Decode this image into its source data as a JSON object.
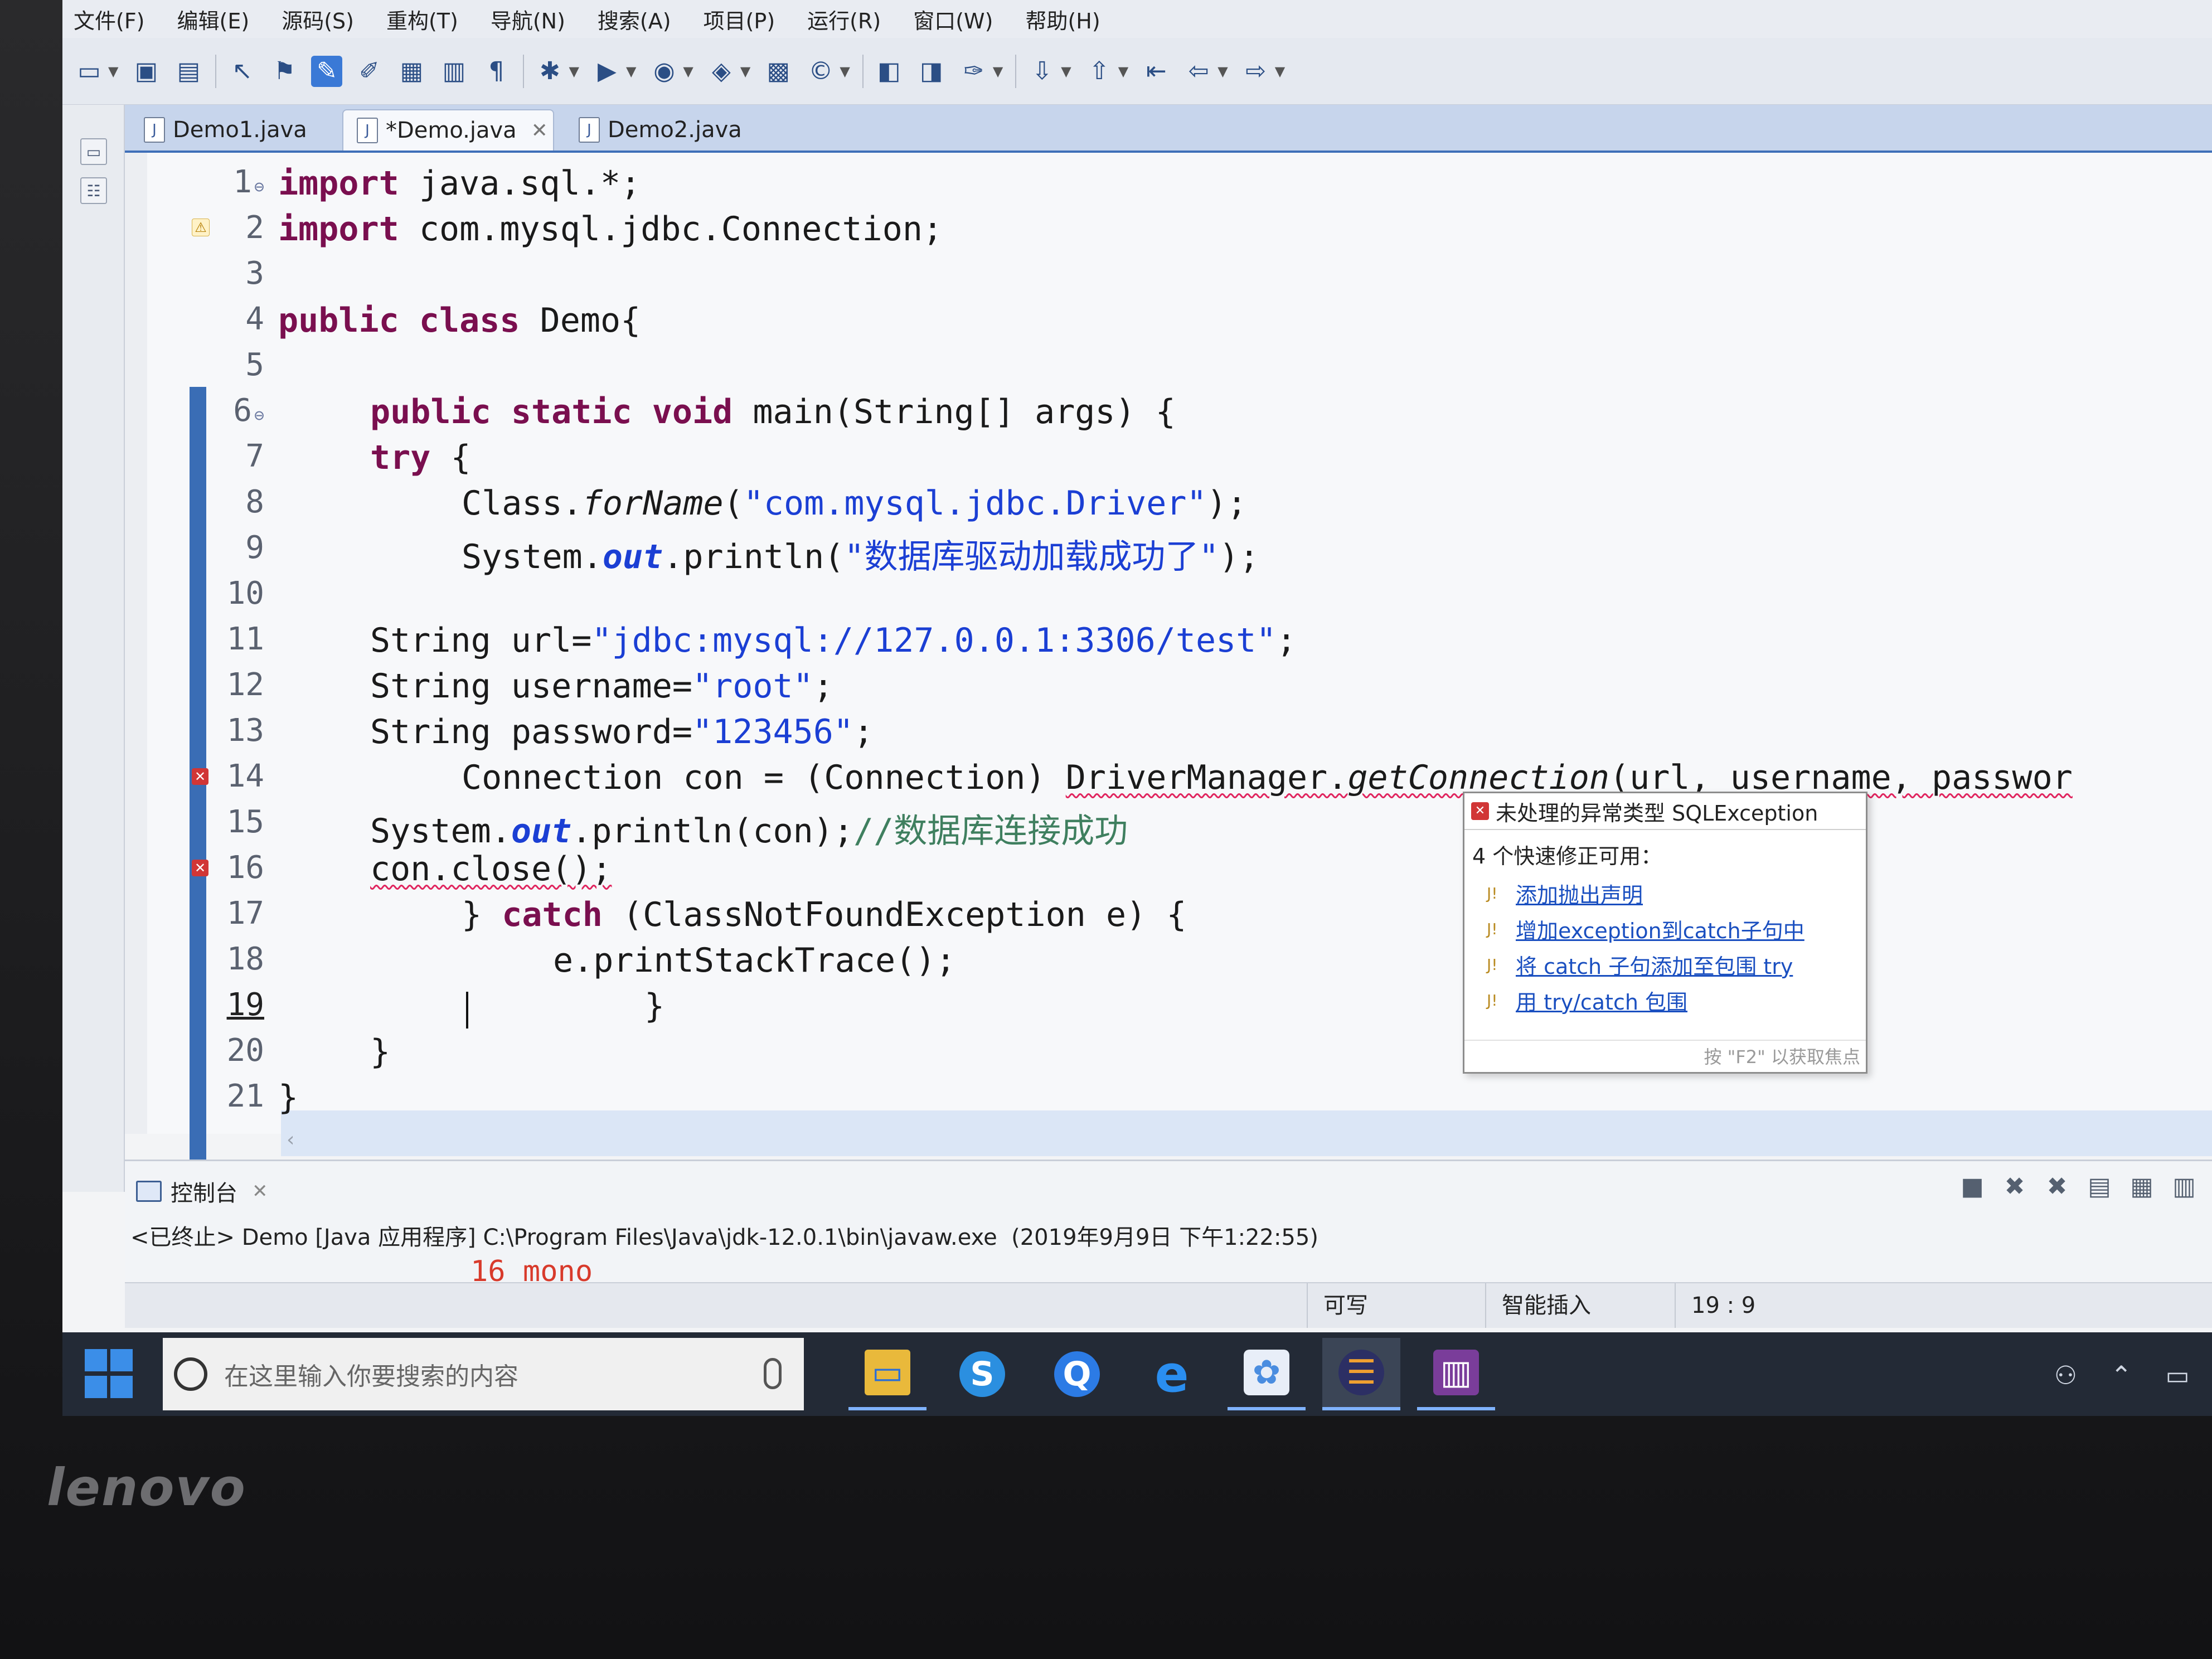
{
  "menubar": {
    "items": [
      "文件(F)",
      "编辑(E)",
      "源码(S)",
      "重构(T)",
      "导航(N)",
      "搜索(A)",
      "项目(P)",
      "运行(R)",
      "窗口(W)",
      "帮助(H)"
    ]
  },
  "tabs": [
    {
      "label": "Demo1.java",
      "active": false
    },
    {
      "label": "*Demo.java",
      "active": true
    },
    {
      "label": "Demo2.java",
      "active": false
    }
  ],
  "editor": {
    "line_numbers": [
      "1",
      "2",
      "3",
      "4",
      "5",
      "6",
      "7",
      "8",
      "9",
      "10",
      "11",
      "12",
      "13",
      "14",
      "15",
      "16",
      "17",
      "18",
      "19",
      "20",
      "21"
    ],
    "current_line": "19",
    "code": {
      "l1_kw": "import",
      "l1_rest": " java.sql.*;",
      "l2_kw": "import",
      "l2_rest": " com.mysql.jdbc.Connection;",
      "l4_kw": "public class",
      "l4_rest": " Demo{",
      "l6_kw": "public static void",
      "l6_rest": " main(String[] args) {",
      "l7_kw": "try",
      "l7_rest": " {",
      "l8_a": "Class.",
      "l8_m": "forName",
      "l8_b": "(",
      "l8_s": "\"com.mysql.jdbc.Driver\"",
      "l8_c": ");",
      "l9_a": "System.",
      "l9_f": "out",
      "l9_b": ".println(",
      "l9_s": "\"数据库驱动加载成功了\"",
      "l9_c": ");",
      "l11_a": "String url=",
      "l11_s": "\"jdbc:mysql://127.0.0.1:3306/test\"",
      "l11_c": ";",
      "l12_a": "String username=",
      "l12_s": "\"root\"",
      "l12_c": ";",
      "l13_a": "String password=",
      "l13_s": "\"123456\"",
      "l13_c": ";",
      "l14_a": "Connection con = (Connection) ",
      "l14_b": "DriverManager.",
      "l14_m": "getConnection",
      "l14_c": "(url, username, passwor",
      "l15_a": "System.",
      "l15_f": "out",
      "l15_b": ".println(con);",
      "l15_cmt": "//数据库连接成功",
      "l16_a": "con.close();",
      "l17_a": "} ",
      "l17_kw": "catch",
      "l17_b": " (ClassNotFoundException e) {",
      "l18_a": "e.printStackTrace();",
      "l19_a": "}",
      "l20_a": "}",
      "l21_a": "}"
    }
  },
  "quickfix": {
    "title": "未处理的异常类型 SQLException",
    "subtitle": "4 个快速修正可用：",
    "fixes": [
      "添加抛出声明",
      "增加exception到catch子句中",
      "将 catch 子句添加至包围 try",
      "用 try/catch 包围"
    ],
    "footer": "按 \"F2\" 以获取焦点"
  },
  "console": {
    "tab_label": "控制台",
    "status_line": "<已终止> Demo [Java 应用程序] C:\\Program Files\\Java\\jdk-12.0.1\\bin\\javaw.exe  (2019年9月9日 下午1:22:55)",
    "output_partial": "16 mono"
  },
  "statusbar": {
    "writable": "可写",
    "insert_mode": "智能插入",
    "position": "19 : 9"
  },
  "taskbar": {
    "search_placeholder": "在这里输入你要搜索的内容"
  },
  "brand": "lenovo",
  "colors": {
    "keyword": "#7a0f4f",
    "string": "#1b3fd4",
    "comment": "#3f7f5f",
    "error": "#d13636",
    "link": "#1a4fc0",
    "taskbar": "#232a36"
  }
}
